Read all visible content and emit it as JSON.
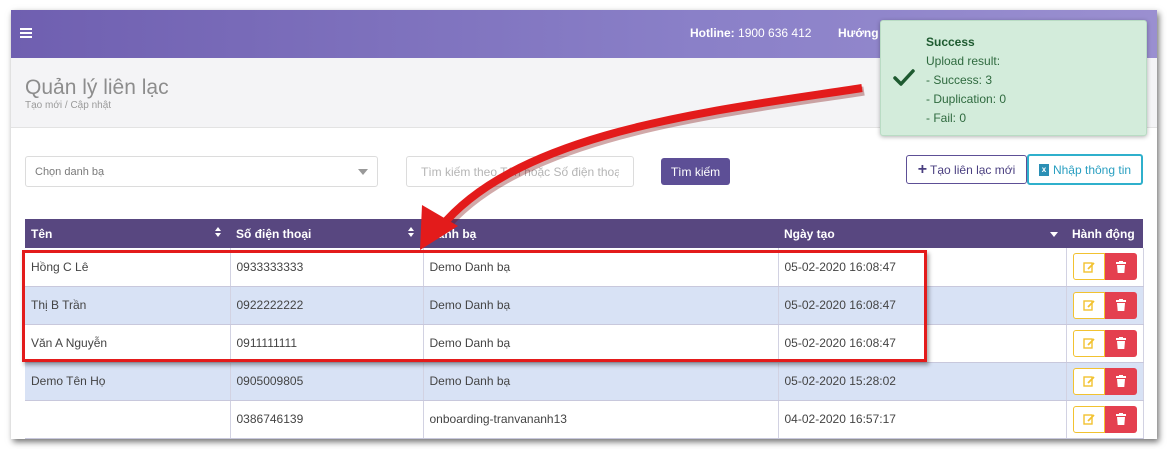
{
  "header": {
    "hotline_label": "Hotline:",
    "hotline_number": "1900 636 412",
    "guide_label": "Hướng",
    "colors": {
      "bar_start": "#6f5fb0",
      "bar_end": "#9a8fd0"
    }
  },
  "page": {
    "title": "Quản lý liên lạc",
    "subtitle": "Tạo mới / Cập nhật"
  },
  "filters": {
    "phonebook_select": "Chọn danh bạ",
    "search_placeholder": "Tìm kiếm theo Tên hoặc Số điện thoại",
    "search_button": "Tìm kiếm",
    "add_button": "Tạo liên lạc mới",
    "import_button": "Nhập thông tin"
  },
  "table": {
    "columns": [
      "Tên",
      "Số điện thoại",
      "Danh bạ",
      "Ngày tạo",
      "Hành động"
    ],
    "rows": [
      {
        "name": "Hồng C Lê",
        "phone": "0933333333",
        "book": "Demo Danh bạ",
        "created": "05-02-2020 16:08:47"
      },
      {
        "name": "Thị B Trần",
        "phone": "0922222222",
        "book": "Demo Danh bạ",
        "created": "05-02-2020 16:08:47"
      },
      {
        "name": "Văn A Nguyễn",
        "phone": "0911111111",
        "book": "Demo Danh bạ",
        "created": "05-02-2020 16:08:47"
      },
      {
        "name": "Demo Tên Họ",
        "phone": "0905009805",
        "book": "Demo Danh bạ",
        "created": "05-02-2020 15:28:02"
      },
      {
        "name": "",
        "phone": "0386746139",
        "book": "onboarding-tranvananh13",
        "created": "04-02-2020 16:57:17"
      }
    ]
  },
  "toast": {
    "title": "Success",
    "line1": "Upload result:",
    "line2": "- Success: 3",
    "line3": "- Duplication: 0",
    "line4": "- Fail: 0",
    "icon": "check-icon"
  },
  "annotation": {
    "color": "#e31b1b"
  }
}
